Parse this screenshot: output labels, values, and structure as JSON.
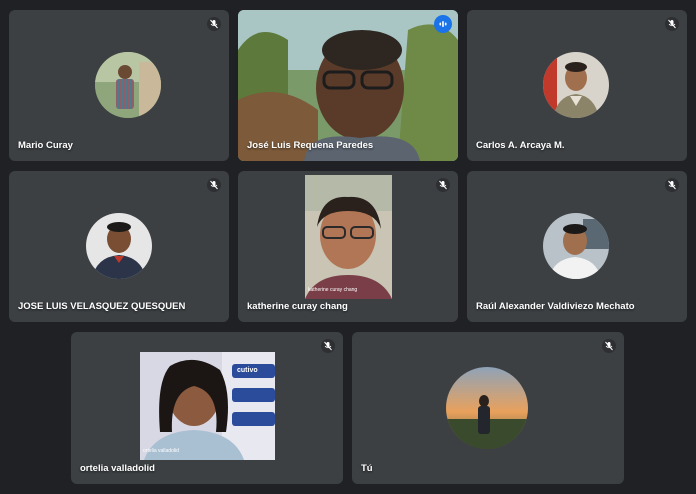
{
  "participants": [
    {
      "name": "Mario Curay",
      "muted": true
    },
    {
      "name": "José Luis Requena Paredes",
      "speaking": true
    },
    {
      "name": "Carlos A. Arcaya M.",
      "muted": true
    },
    {
      "name": "JOSE LUIS VELASQUEZ QUESQUEN",
      "muted": true
    },
    {
      "name": "katherine curay chang",
      "muted": true,
      "video_caption": "katherine curay chang"
    },
    {
      "name": "Raúl Alexander Valdiviezo Mechato",
      "muted": true
    },
    {
      "name": "ortelia valladolid",
      "muted": true,
      "video_caption": "ortelia valladolid",
      "banner_text": "cutivo"
    },
    {
      "name": "Tú",
      "muted": true
    }
  ],
  "icons": {
    "muted": "mic-off-icon",
    "speaking": "audio-levels-icon"
  },
  "colors": {
    "background": "#202124",
    "tile": "#3c4043",
    "active_speaker_border": "#8ab4f8",
    "speaking_badge": "#1a73e8"
  }
}
